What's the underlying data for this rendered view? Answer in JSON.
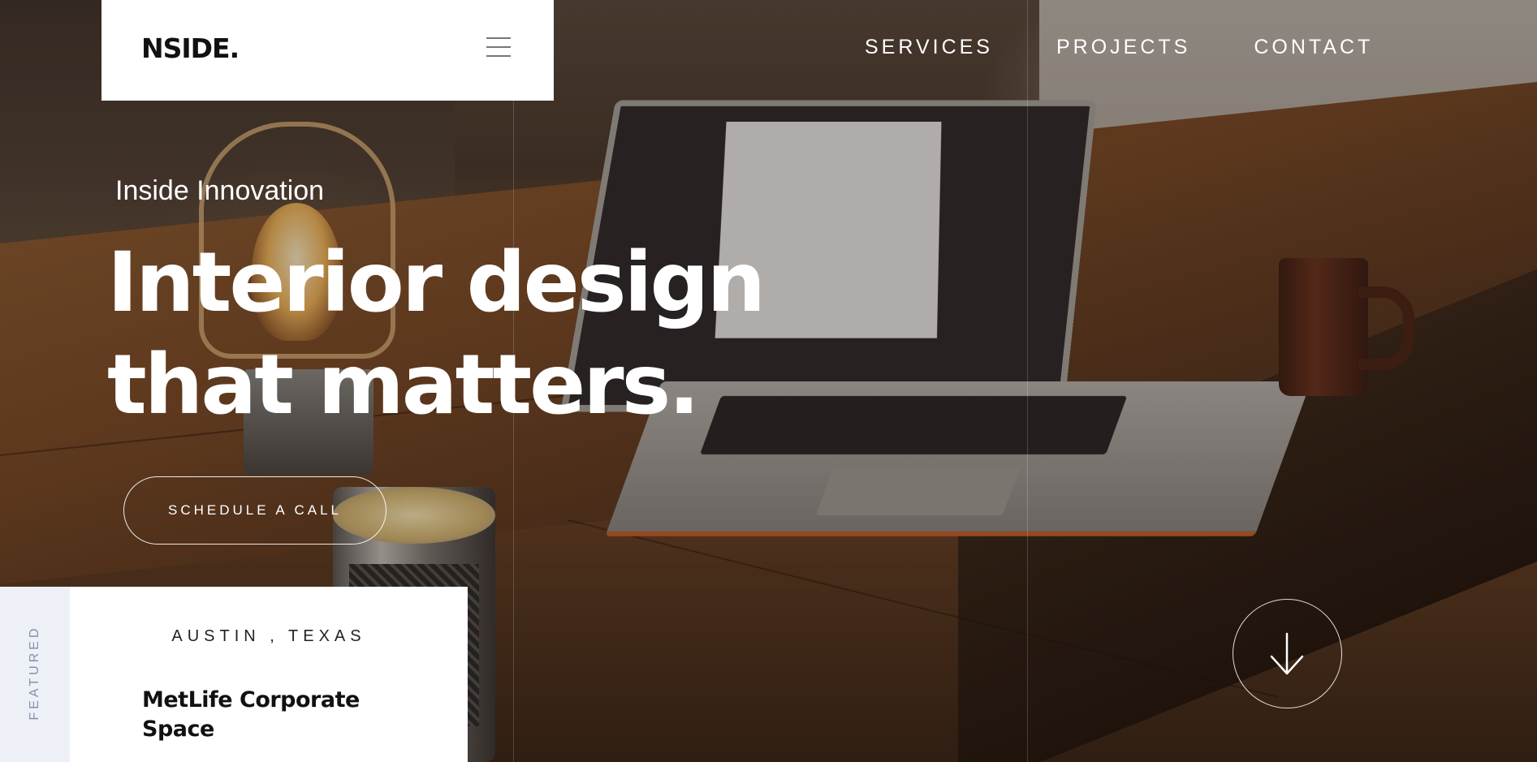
{
  "brand": {
    "logo": "NSIDE."
  },
  "nav": {
    "items": [
      {
        "label": "SERVICES"
      },
      {
        "label": "PROJECTS"
      },
      {
        "label": "CONTACT"
      }
    ]
  },
  "hero": {
    "eyebrow": "Inside Innovation",
    "headline_line1": "Interior design",
    "headline_line2": "that matters.",
    "cta_label": "SCHEDULE A CALL"
  },
  "featured": {
    "tag": "FEATURED",
    "location": "AUSTIN , TEXAS",
    "title": "MetLife Corporate Space"
  },
  "icons": {
    "menu": "hamburger-menu-icon",
    "scroll": "arrow-down-icon"
  },
  "colors": {
    "text_light": "#ffffff",
    "text_dark": "#111111",
    "featured_side": "#eef0f8"
  }
}
